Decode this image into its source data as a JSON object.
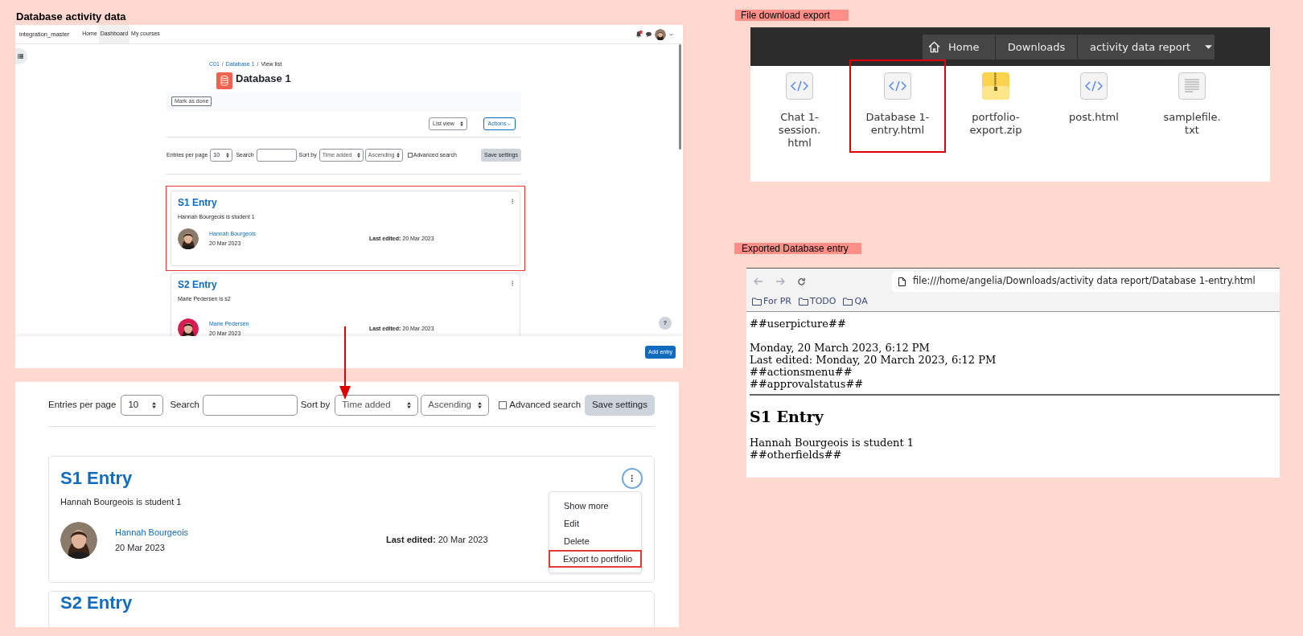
{
  "title": "Database activity data",
  "moodle_page": {
    "brand": "integration_master",
    "nav": [
      {
        "label": "Home",
        "selected": false
      },
      {
        "label": "Dashboard",
        "selected": true
      },
      {
        "label": "My courses",
        "selected": false
      }
    ],
    "breadcrumb": {
      "items": [
        "C01",
        "Database 1",
        "View list"
      ],
      "separator": "/"
    },
    "heading": "Database 1",
    "mark_done": "Mark as done",
    "view_select": "List view",
    "actions": "Actions",
    "settings": {
      "entries_label": "Entries per page",
      "per_page": "10",
      "search_label": "Search",
      "sort_label": "Sort by",
      "sort_field": "Time added",
      "sort_order": "Ascending",
      "advanced_label": "Advanced search",
      "advanced_checked": false,
      "save": "Save settings"
    },
    "entries": [
      {
        "title": "S1 Entry",
        "description": "Hannah Bourgeois is student 1",
        "author": "Hannah Bourgeois",
        "date": "20 Mar 2023",
        "last_edited_label": "Last edited:",
        "last_edited": "20 Mar 2023",
        "highlighted": true
      },
      {
        "title": "S2 Entry",
        "description": "Marie Pedersen is s2",
        "author": "Marie Pedersen",
        "date": "20 Mar 2023",
        "last_edited_label": "Last edited:",
        "last_edited": "20 Mar 2023",
        "highlighted": false
      }
    ],
    "help": "?",
    "add_entry": "Add entry"
  },
  "zoomed_view": {
    "settings": {
      "entries_label": "Entries per page",
      "per_page": "10",
      "search_label": "Search",
      "sort_label": "Sort by",
      "sort_field": "Time added",
      "sort_order": "Ascending",
      "advanced_label": "Advanced search",
      "advanced_checked": false,
      "save": "Save settings"
    },
    "entry": {
      "title": "S1 Entry",
      "description": "Hannah Bourgeois is student 1",
      "author": "Hannah Bourgeois",
      "date": "20 Mar 2023",
      "last_edited_label": "Last edited:",
      "last_edited": "20 Mar 2023"
    },
    "menu": [
      {
        "label": "Show more",
        "highlighted": false
      },
      {
        "label": "Edit",
        "highlighted": false
      },
      {
        "label": "Delete",
        "highlighted": false
      },
      {
        "label": "Export to portfolio",
        "highlighted": true
      }
    ],
    "next_entry_title": "S2 Entry"
  },
  "file_download": {
    "label": "File download export",
    "path": [
      {
        "label": "Home",
        "kind": "home"
      },
      {
        "label": "Downloads",
        "kind": "folder"
      },
      {
        "label": "activity data report",
        "kind": "dropdown"
      }
    ],
    "files": [
      {
        "name": "Chat 1-\nsession.\nhtml",
        "kind": "html",
        "highlighted": false
      },
      {
        "name": "Database 1-\nentry.html",
        "kind": "html",
        "highlighted": true
      },
      {
        "name": "portfolio-\nexport.zip",
        "kind": "zip",
        "highlighted": false
      },
      {
        "name": "post.html",
        "kind": "html",
        "highlighted": false
      },
      {
        "name": "samplefile.\ntxt",
        "kind": "text",
        "highlighted": false
      }
    ]
  },
  "exported_entry": {
    "label": "Exported Database entry",
    "url": "file:///home/angelia/Downloads/activity data report/Database 1-entry.html",
    "bookmarks": [
      "For PR",
      "TODO",
      "QA"
    ],
    "header_lines": [
      "##userpicture##"
    ],
    "meta_lines": [
      "Monday, 20 March 2023, 6:12 PM",
      "Last edited: Monday, 20 March 2023, 6:12 PM",
      "##actionsmenu##",
      "##approvalstatus##"
    ],
    "heading": "S1 Entry",
    "body_lines": [
      "Hannah Bourgeois is student 1",
      "##otherfields##"
    ]
  }
}
